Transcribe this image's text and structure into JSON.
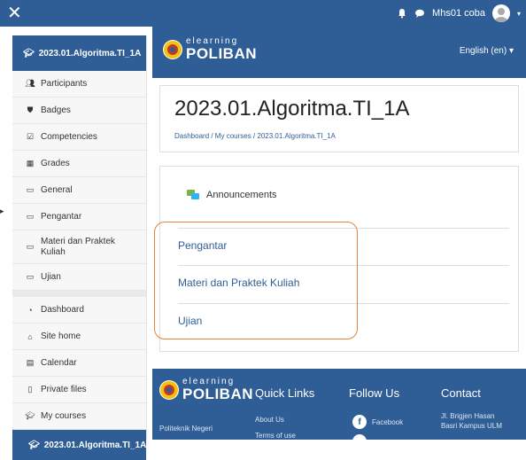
{
  "topbar": {
    "user_name": "Mhs01 coba"
  },
  "header": {
    "logo_small": "elearning",
    "logo_big": "POLIBAN",
    "language": "English (en) ▾"
  },
  "sidebar": {
    "course_short": "2023.01.Algoritma.TI_1A",
    "items": [
      {
        "label": "Participants",
        "icon": "users-icon"
      },
      {
        "label": "Badges",
        "icon": "shield-icon"
      },
      {
        "label": "Competencies",
        "icon": "checkbox-icon"
      },
      {
        "label": "Grades",
        "icon": "table-icon"
      },
      {
        "label": "General",
        "icon": "folder-icon"
      },
      {
        "label": "Pengantar",
        "icon": "folder-icon"
      },
      {
        "label": "Materi dan Praktek Kuliah",
        "icon": "folder-icon"
      },
      {
        "label": "Ujian",
        "icon": "folder-icon"
      }
    ],
    "nav": [
      {
        "label": "Dashboard",
        "icon": "dashboard-icon"
      },
      {
        "label": "Site home",
        "icon": "home-icon"
      },
      {
        "label": "Calendar",
        "icon": "calendar-icon"
      },
      {
        "label": "Private files",
        "icon": "file-icon"
      },
      {
        "label": "My courses",
        "icon": "graduation-cap-icon"
      }
    ],
    "active_course": "2023.01.Algoritma.TI_1A"
  },
  "course": {
    "title": "2023.01.Algoritma.TI_1A",
    "breadcrumb": "Dashboard / My courses / 2023.01.Algoritma.TI_1A"
  },
  "content": {
    "announcements": "Announcements",
    "sections": [
      "Pengantar",
      "Materi dan Praktek Kuliah",
      "Ujian"
    ]
  },
  "footer": {
    "logo_small": "elearning",
    "logo_big": "POLIBAN",
    "org": "Politeknik Negeri",
    "quick_links_title": "Quick Links",
    "quick_links": [
      "About Us",
      "Terms of use"
    ],
    "follow_title": "Follow Us",
    "facebook": "Facebook",
    "contact_title": "Contact",
    "contact_line1": "Jl. Brigjen Hasan",
    "contact_line2": "Basri Kampus ULM"
  },
  "colors": {
    "primary": "#2f5e97",
    "highlight": "#e3833a"
  }
}
